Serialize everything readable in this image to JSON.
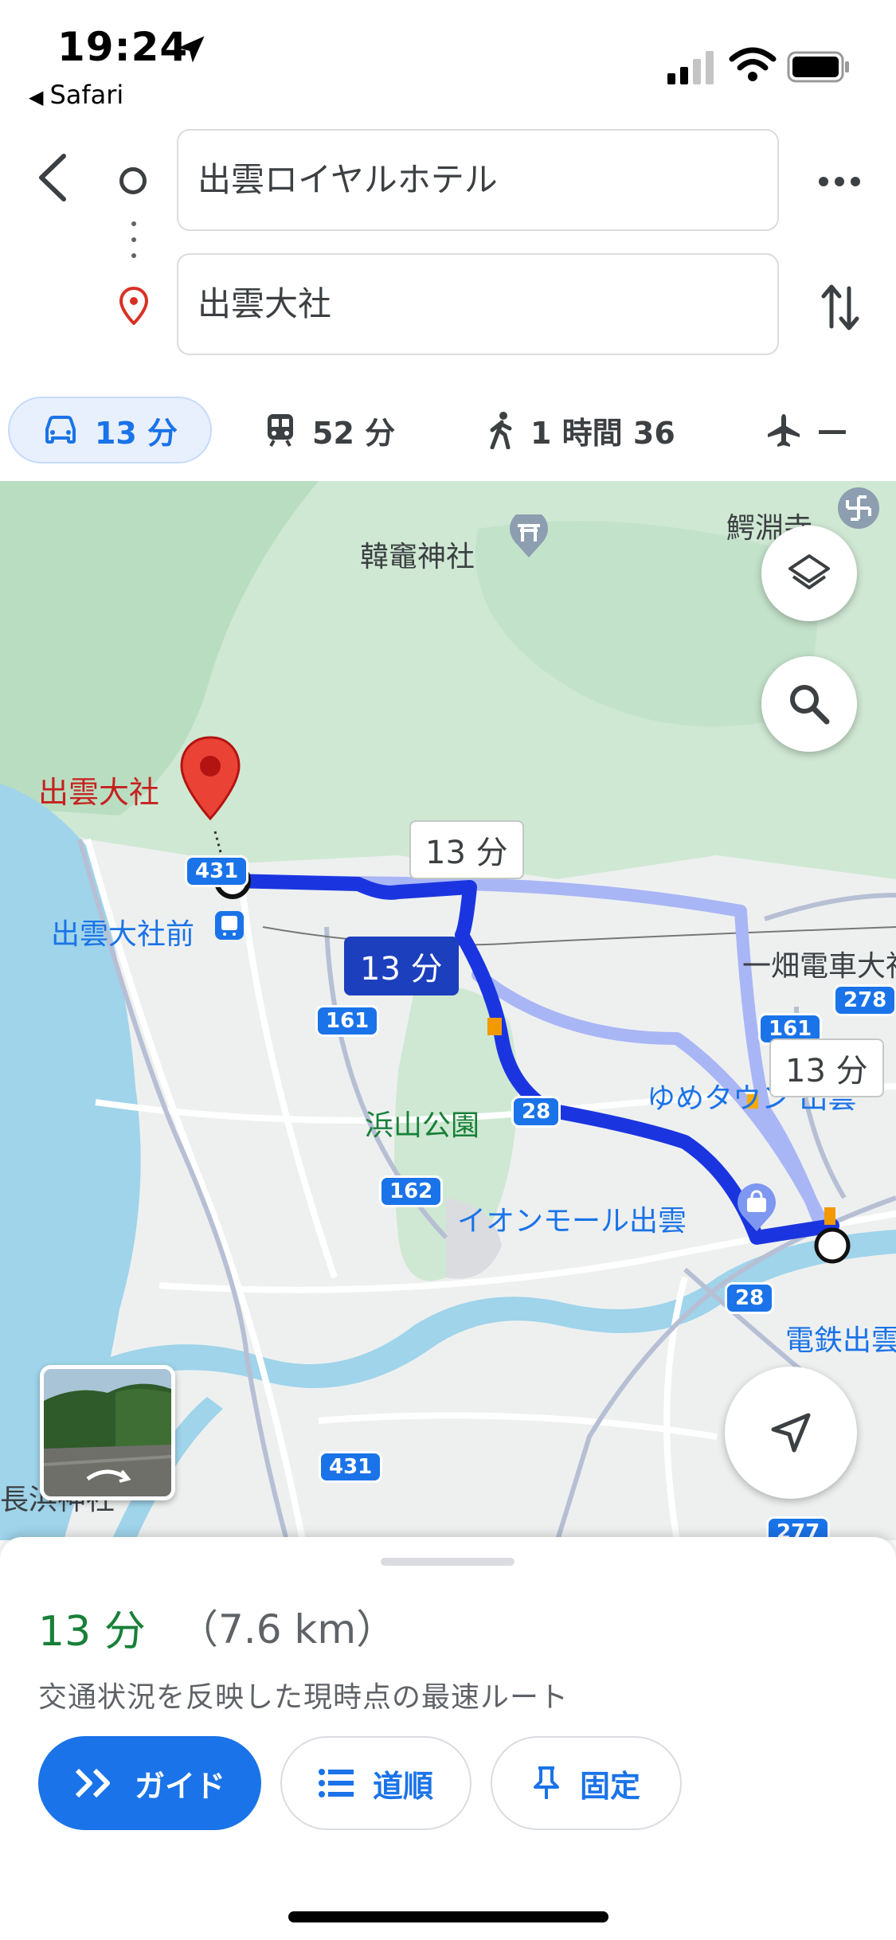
{
  "status_bar": {
    "time": "19:24",
    "back_app": "Safari"
  },
  "route": {
    "origin": "出雲ロイヤルホテル",
    "destination": "出雲大社"
  },
  "modes": [
    {
      "icon": "car-icon",
      "label": "13 分",
      "selected": true
    },
    {
      "icon": "train-icon",
      "label": "52 分",
      "selected": false
    },
    {
      "icon": "walk-icon",
      "label": "1 時間 36",
      "selected": false
    },
    {
      "icon": "flight-icon",
      "label": "—",
      "selected": false
    }
  ],
  "map": {
    "labels": {
      "kanzaki_shrine": "韓竈神社",
      "temple_top_right": "鰐淵寺",
      "izumo_taisha": "出雲大社",
      "izumo_taisha_mae": "出雲大社前",
      "ichibata_line": "一畑電車大社",
      "hamayama_park": "浜山公園",
      "youme_town": "ゆめタウン 出雲",
      "aeon_mall": "イオンモール出雲",
      "dentetsu_izumo": "電鉄出雲",
      "nagahama_shrine": "長浜神社"
    },
    "road_shields": {
      "r431_top": "431",
      "r161_left": "161",
      "r278": "278",
      "r161_right": "161",
      "r28_mid": "28",
      "r162": "162",
      "r28_bottom": "28",
      "r431_bottom": "431",
      "r277": "277"
    },
    "route_callouts": {
      "selected": "13 分",
      "alt_1": "13 分",
      "alt_2": "13 分"
    },
    "colors": {
      "route_primary": "#1a35e0",
      "route_alt": "#a9b6f5",
      "water": "#9fd4ea",
      "forest": "#cfe8d3",
      "pin": "#ea4335"
    }
  },
  "sheet": {
    "duration": "13 分",
    "distance": "（7.6 km）",
    "subtitle": "交通状況を反映した現時点の最速ルート",
    "buttons": {
      "guide": "ガイド",
      "steps": "道順",
      "pin": "固定"
    }
  }
}
